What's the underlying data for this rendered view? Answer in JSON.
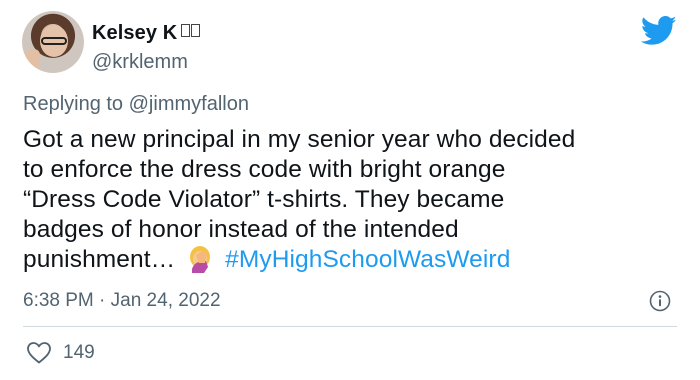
{
  "author": {
    "name": "Kelsey K",
    "handle": "@krklemm",
    "avatar_icon": "profile-photo"
  },
  "reply": {
    "prefix": "Replying to",
    "handle": "@jimmyfallon"
  },
  "tweet": {
    "text_lines": [
      "Got a new principal in my senior year who decided",
      "to enforce the dress code with bright orange",
      "“Dress Code Violator” t-shirts. They became",
      "badges of honor instead of the intended",
      "punishment…"
    ],
    "emoji": "facepalm-emoji",
    "hashtag": "#MyHighSchoolWasWeird"
  },
  "meta": {
    "timestamp": "6:38 PM · Jan 24, 2022",
    "like_count": "149"
  },
  "colors": {
    "accent": "#1d9bf0",
    "secondary_text": "#536471",
    "divider": "#cfd9de"
  },
  "icons": {
    "logo": "twitter-bird-icon",
    "info": "info-icon",
    "like": "heart-icon"
  }
}
